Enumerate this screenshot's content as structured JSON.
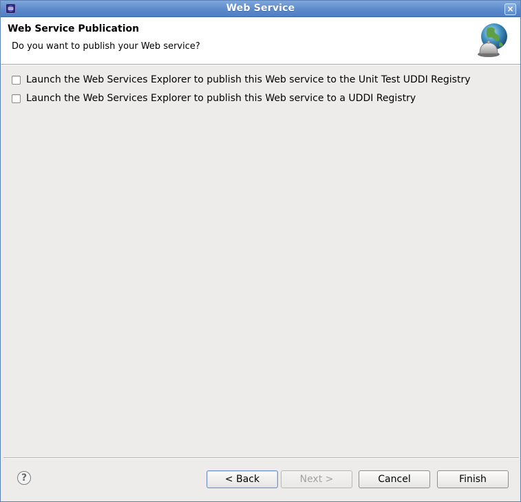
{
  "window": {
    "title": "Web Service",
    "close_glyph": "×"
  },
  "banner": {
    "title": "Web Service Publication",
    "subtitle": "Do you want to publish your Web service?",
    "icon": "globe-bell-icon"
  },
  "options": [
    {
      "label": "Launch the Web Services Explorer to publish this Web service to the Unit Test UDDI Registry",
      "checked": false
    },
    {
      "label": "Launch the Web Services Explorer to publish this Web service to a UDDI Registry",
      "checked": false
    }
  ],
  "footer": {
    "help_glyph": "?",
    "back_label": "< Back",
    "next_label": "Next >",
    "cancel_label": "Cancel",
    "finish_label": "Finish"
  },
  "colors": {
    "titlebar": "#5d8acb",
    "dialog_bg": "#edeceb",
    "disabled_text": "#a3a2a0"
  }
}
